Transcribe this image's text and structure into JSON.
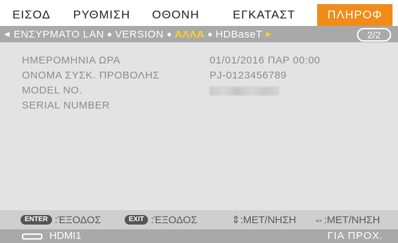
{
  "tabs": [
    "ΕΙΣΟΔ",
    "ΡΥΘΜΙΣΗ",
    "ΟΘΟΝΗ",
    "ΕΓΚΑΤΑΣΤ",
    "ΠΛΗΡΟΦ"
  ],
  "active_tab": "ΠΛΗΡΟΦ",
  "subtabs": [
    "ΕΝΣΥΡΜΑΤΟ LAN",
    "VERSION",
    "ΑΛΛΑ",
    "HDBaseT"
  ],
  "active_subtab": "ΑΛΛΑ",
  "page_indicator": "2/2",
  "info": {
    "date_label": "ΗΜΕΡΟΜΗΝΙΑ ΩΡΑ",
    "date_value": "01/01/2016 ΠΑΡ 00:00",
    "name_label": "ΟΝΟΜΑ ΣΥΣΚ. ΠΡΟΒΟΛΗΣ",
    "name_value": "PJ-0123456789",
    "model_label": "MODEL NO.",
    "serial_label": "SERIAL NUMBER"
  },
  "keys": {
    "enter_btn": "ENTER",
    "enter_hint": ":ΈΞΟΔΟΣ",
    "exit_btn": "EXIT",
    "exit_hint": ":ΈΞΟΔΟΣ",
    "move_hint": "⇕:ΜΕΤ/ΝΗΣΗ",
    "move2_hint": "⇔:ΜΕΤ/ΝΗΣΗ"
  },
  "status": {
    "source": "HDMI1",
    "help": "ΓΙΑ ΠΡΟΧ."
  },
  "colors": {
    "active_tab": "#f08c1a",
    "active_subtab": "#ffd21f",
    "subbar": "#a9a9a9",
    "content_bg": "#e3e3e3"
  }
}
